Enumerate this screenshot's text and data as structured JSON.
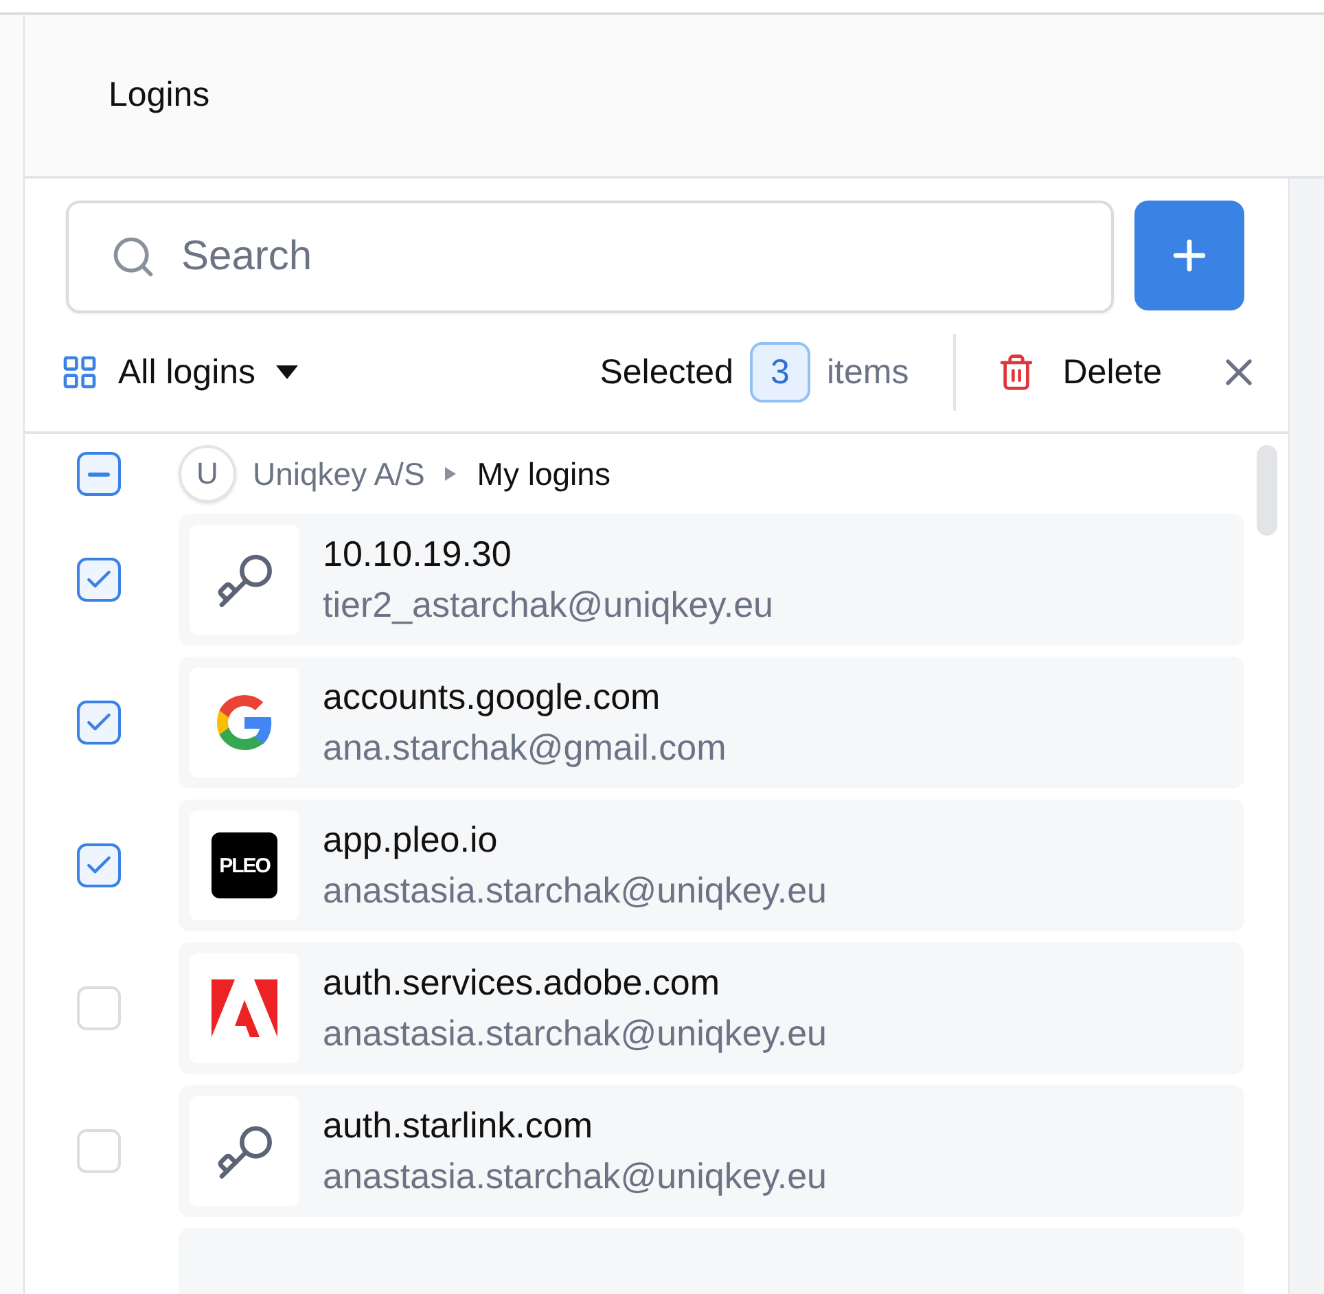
{
  "header": {
    "title": "Logins"
  },
  "search": {
    "placeholder": "Search"
  },
  "toolbar": {
    "filter": "All logins",
    "selected_prefix": "Selected",
    "selected_count": "3",
    "selected_suffix": "items",
    "delete": "Delete"
  },
  "group": {
    "indeterminate": true,
    "avatar": "U",
    "organization": "Uniqkey A/S",
    "folder": "My logins"
  },
  "logins": [
    {
      "kind": "key",
      "title": "10.10.19.30",
      "username": "tier2_astarchak@uniqkey.eu",
      "checked": true
    },
    {
      "kind": "google",
      "title": "accounts.google.com",
      "username": "ana.starchak@gmail.com",
      "checked": true
    },
    {
      "kind": "pleo",
      "logo_text": "PLEO",
      "title": "app.pleo.io",
      "username": "anastasia.starchak@uniqkey.eu",
      "checked": true
    },
    {
      "kind": "adobe",
      "title": "auth.services.adobe.com",
      "username": "anastasia.starchak@uniqkey.eu",
      "checked": false
    },
    {
      "kind": "key",
      "title": "auth.starlink.com",
      "username": "anastasia.starchak@uniqkey.eu",
      "checked": false
    }
  ]
}
